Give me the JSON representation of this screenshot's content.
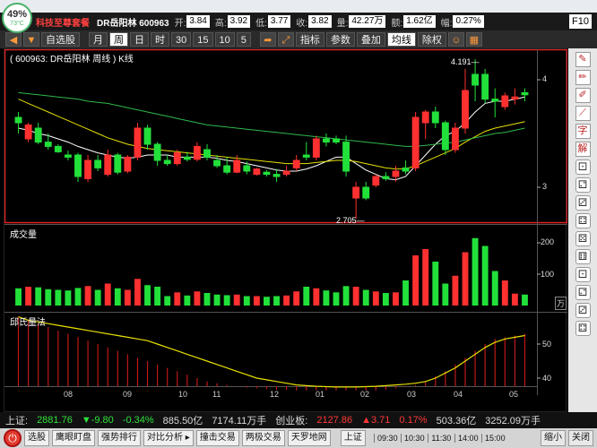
{
  "system": {
    "cpu_percent": "49%",
    "temperature": "73°C"
  },
  "header": {
    "brand": "科技至尊套餐",
    "stock": "DR岳阳林  600963",
    "fields": [
      {
        "label": "开:",
        "value": "3.84"
      },
      {
        "label": "高:",
        "value": "3.92"
      },
      {
        "label": "低:",
        "value": "3.77"
      },
      {
        "label": "收:",
        "value": "3.82"
      },
      {
        "label": "量:",
        "value": "42.27万"
      },
      {
        "label": "额:",
        "value": "1.62亿"
      },
      {
        "label": "幅:",
        "value": "0.27%"
      }
    ],
    "f10": "F10"
  },
  "toolbar": {
    "nav_left": "◀",
    "nav_down": "▼",
    "self_select": "自选股",
    "periods": [
      "月",
      "周",
      "日",
      "时",
      "30",
      "15",
      "10",
      "5"
    ],
    "active_period": "周",
    "indicator": "指标",
    "params": "参数",
    "overlay": "叠加",
    "ma_line": "均线",
    "ex_right": "除权"
  },
  "chart": {
    "title": "( 600963: DR岳阳林 周线 ) K线",
    "volume_title": "成交量",
    "osc_title": "邱氏量法",
    "price_ticks": [
      "4",
      "3"
    ],
    "volume_ticks": [
      "200",
      "100"
    ],
    "volume_unit": "万",
    "osc_ticks": [
      "50",
      "40"
    ],
    "x_ticks": [
      "08",
      "09",
      "10",
      "11",
      "12",
      "01",
      "02",
      "03",
      "04",
      "05"
    ],
    "high_marker": "4.191",
    "low_marker": "2.705"
  },
  "sidetools_icons": [
    "pen-icon",
    "pencil-icon",
    "brush-icon",
    "slash-icon",
    "text-icon",
    "explain-icon",
    "dice-1-icon",
    "dice-2-icon",
    "dice-3-icon",
    "dice-4-icon",
    "dice-5-icon",
    "dice-6-icon",
    "dice-7-icon",
    "dice-8-icon",
    "dice-9-icon",
    "dice-10-icon"
  ],
  "sidetools_text": {
    "char": "字",
    "explain": "解"
  },
  "status": {
    "sh_label": "上证:",
    "sh_value": "2881.76",
    "sh_change": "▼-9.80",
    "sh_pct": "-0.34%",
    "sh_amount": "885.50亿",
    "sh_volume": "7174.11万手",
    "cy_label": "创业板:",
    "cy_value": "2127.86",
    "cy_change": "▲3.71",
    "cy_pct": "0.17%",
    "cy_amount": "503.36亿",
    "cy_volume": "3252.09万手"
  },
  "bottom": {
    "buttons": [
      "选股",
      "鹰眼盯盘",
      "强势排行",
      "对比分析 ▸",
      "撞击交易",
      "两极交易",
      "天罗地网"
    ],
    "index_button": "上证",
    "times": [
      "09:30",
      "10:30",
      "11:30",
      "14:00",
      "15:00"
    ],
    "shrink": "缩小",
    "close": "关闭"
  },
  "colors": {
    "up": "#ff3030",
    "down": "#22e03a",
    "ma_white": "#ffffff",
    "ma_yellow": "#e8e000",
    "ma_green": "#2fb84a",
    "frame": "#e02020"
  },
  "chart_data": {
    "type": "candlestick",
    "period": "weekly",
    "price_axis": {
      "visible_ticks": [
        3,
        4
      ],
      "range_approx": [
        2.65,
        4.35
      ]
    },
    "extremes": {
      "high": 4.191,
      "low": 2.705
    },
    "candles": [
      {
        "o": 3.65,
        "h": 3.7,
        "l": 3.5,
        "c": 3.6,
        "up": false
      },
      {
        "o": 3.45,
        "h": 3.6,
        "l": 3.42,
        "c": 3.58,
        "up": true
      },
      {
        "o": 3.55,
        "h": 3.6,
        "l": 3.4,
        "c": 3.42,
        "up": false
      },
      {
        "o": 3.42,
        "h": 3.5,
        "l": 3.35,
        "c": 3.38,
        "up": false
      },
      {
        "o": 3.38,
        "h": 3.4,
        "l": 3.32,
        "c": 3.33,
        "up": false
      },
      {
        "o": 3.28,
        "h": 3.34,
        "l": 3.25,
        "c": 3.3,
        "up": false
      },
      {
        "o": 3.3,
        "h": 3.32,
        "l": 3.05,
        "c": 3.1,
        "up": false
      },
      {
        "o": 3.08,
        "h": 3.3,
        "l": 3.05,
        "c": 3.25,
        "up": true
      },
      {
        "o": 3.25,
        "h": 3.3,
        "l": 3.15,
        "c": 3.18,
        "up": false
      },
      {
        "o": 3.12,
        "h": 3.35,
        "l": 3.1,
        "c": 3.3,
        "up": true
      },
      {
        "o": 3.3,
        "h": 3.32,
        "l": 3.12,
        "c": 3.14,
        "up": false
      },
      {
        "o": 3.15,
        "h": 3.3,
        "l": 3.13,
        "c": 3.28,
        "up": true
      },
      {
        "o": 3.28,
        "h": 3.6,
        "l": 3.25,
        "c": 3.55,
        "up": true
      },
      {
        "o": 3.55,
        "h": 3.58,
        "l": 3.35,
        "c": 3.4,
        "up": false
      },
      {
        "o": 3.4,
        "h": 3.42,
        "l": 3.2,
        "c": 3.25,
        "up": false
      },
      {
        "o": 3.25,
        "h": 3.3,
        "l": 3.2,
        "c": 3.22,
        "up": false
      },
      {
        "o": 3.22,
        "h": 3.35,
        "l": 3.2,
        "c": 3.32,
        "up": true
      },
      {
        "o": 3.28,
        "h": 3.33,
        "l": 3.24,
        "c": 3.26,
        "up": false
      },
      {
        "o": 3.26,
        "h": 3.42,
        "l": 3.24,
        "c": 3.38,
        "up": true
      },
      {
        "o": 3.35,
        "h": 3.4,
        "l": 3.25,
        "c": 3.28,
        "up": false
      },
      {
        "o": 3.25,
        "h": 3.3,
        "l": 3.18,
        "c": 3.2,
        "up": false
      },
      {
        "o": 3.2,
        "h": 3.28,
        "l": 3.12,
        "c": 3.14,
        "up": false
      },
      {
        "o": 3.14,
        "h": 3.3,
        "l": 3.13,
        "c": 3.25,
        "up": true
      },
      {
        "o": 3.2,
        "h": 3.24,
        "l": 3.12,
        "c": 3.15,
        "up": false
      },
      {
        "o": 3.12,
        "h": 3.18,
        "l": 3.11,
        "c": 3.17,
        "up": true
      },
      {
        "o": 3.12,
        "h": 3.16,
        "l": 3.1,
        "c": 3.14,
        "up": false
      },
      {
        "o": 3.1,
        "h": 3.17,
        "l": 3.05,
        "c": 3.12,
        "up": false
      },
      {
        "o": 3.12,
        "h": 3.2,
        "l": 3.1,
        "c": 3.15,
        "up": true
      },
      {
        "o": 3.18,
        "h": 3.3,
        "l": 3.15,
        "c": 3.25,
        "up": true
      },
      {
        "o": 3.3,
        "h": 3.42,
        "l": 3.25,
        "c": 3.28,
        "up": false
      },
      {
        "o": 3.28,
        "h": 3.48,
        "l": 3.25,
        "c": 3.45,
        "up": true
      },
      {
        "o": 3.45,
        "h": 3.5,
        "l": 3.38,
        "c": 3.42,
        "up": false
      },
      {
        "o": 3.45,
        "h": 3.48,
        "l": 3.4,
        "c": 3.42,
        "up": false
      },
      {
        "o": 3.42,
        "h": 3.48,
        "l": 3.1,
        "c": 3.15,
        "up": false
      },
      {
        "o": 3.0,
        "h": 3.05,
        "l": 2.705,
        "c": 2.9,
        "up": true
      },
      {
        "o": 2.9,
        "h": 3.05,
        "l": 2.88,
        "c": 3.0,
        "up": false
      },
      {
        "o": 3.02,
        "h": 3.12,
        "l": 3.0,
        "c": 3.1,
        "up": true
      },
      {
        "o": 3.1,
        "h": 3.14,
        "l": 3.06,
        "c": 3.08,
        "up": false
      },
      {
        "o": 3.1,
        "h": 3.2,
        "l": 3.05,
        "c": 3.15,
        "up": true
      },
      {
        "o": 3.15,
        "h": 3.25,
        "l": 3.12,
        "c": 3.18,
        "up": false
      },
      {
        "o": 3.18,
        "h": 3.7,
        "l": 3.15,
        "c": 3.65,
        "up": true
      },
      {
        "o": 3.6,
        "h": 3.72,
        "l": 3.45,
        "c": 3.7,
        "up": true
      },
      {
        "o": 3.7,
        "h": 3.75,
        "l": 3.55,
        "c": 3.6,
        "up": false
      },
      {
        "o": 3.6,
        "h": 3.62,
        "l": 3.3,
        "c": 3.35,
        "up": false
      },
      {
        "o": 3.35,
        "h": 3.6,
        "l": 3.32,
        "c": 3.55,
        "up": true
      },
      {
        "o": 3.55,
        "h": 4.1,
        "l": 3.5,
        "c": 3.9,
        "up": true
      },
      {
        "o": 3.95,
        "h": 4.191,
        "l": 3.8,
        "c": 4.05,
        "up": false
      },
      {
        "o": 4.05,
        "h": 4.1,
        "l": 3.78,
        "c": 3.82,
        "up": false
      },
      {
        "o": 3.82,
        "h": 3.92,
        "l": 3.65,
        "c": 3.8,
        "up": false
      },
      {
        "o": 3.75,
        "h": 3.88,
        "l": 3.72,
        "c": 3.85,
        "up": true
      },
      {
        "o": 3.82,
        "h": 3.92,
        "l": 3.77,
        "c": 3.84,
        "up": true
      },
      {
        "o": 3.88,
        "h": 3.92,
        "l": 3.8,
        "c": 3.86,
        "up": false
      }
    ],
    "ma_white": [
      3.55,
      3.53,
      3.5,
      3.48,
      3.45,
      3.42,
      3.38,
      3.35,
      3.32,
      3.3,
      3.28,
      3.27,
      3.28,
      3.3,
      3.3,
      3.3,
      3.28,
      3.28,
      3.28,
      3.28,
      3.27,
      3.25,
      3.24,
      3.22,
      3.2,
      3.18,
      3.16,
      3.15,
      3.15,
      3.17,
      3.2,
      3.24,
      3.28,
      3.28,
      3.22,
      3.16,
      3.12,
      3.08,
      3.07,
      3.1,
      3.2,
      3.3,
      3.4,
      3.48,
      3.52,
      3.6,
      3.7,
      3.78,
      3.8,
      3.8,
      3.82,
      3.84
    ],
    "ma_yellow": [
      3.82,
      3.78,
      3.74,
      3.7,
      3.66,
      3.62,
      3.58,
      3.54,
      3.5,
      3.46,
      3.43,
      3.4,
      3.38,
      3.36,
      3.35,
      3.34,
      3.33,
      3.32,
      3.31,
      3.3,
      3.29,
      3.28,
      3.27,
      3.26,
      3.25,
      3.24,
      3.23,
      3.22,
      3.22,
      3.22,
      3.23,
      3.24,
      3.25,
      3.25,
      3.24,
      3.22,
      3.2,
      3.18,
      3.17,
      3.17,
      3.2,
      3.24,
      3.28,
      3.32,
      3.36,
      3.42,
      3.47,
      3.52,
      3.55,
      3.57,
      3.59,
      3.61
    ],
    "ma_green": [
      3.88,
      3.87,
      3.86,
      3.85,
      3.84,
      3.83,
      3.82,
      3.8,
      3.79,
      3.78,
      3.76,
      3.74,
      3.72,
      3.7,
      3.68,
      3.66,
      3.64,
      3.62,
      3.6,
      3.58,
      3.57,
      3.56,
      3.55,
      3.54,
      3.53,
      3.52,
      3.51,
      3.5,
      3.49,
      3.48,
      3.47,
      3.46,
      3.45,
      3.44,
      3.43,
      3.42,
      3.41,
      3.4,
      3.39,
      3.38,
      3.38,
      3.39,
      3.4,
      3.41,
      3.42,
      3.44,
      3.46,
      3.48,
      3.5,
      3.51,
      3.53,
      3.55
    ],
    "volume": [
      {
        "v": 55,
        "up": false
      },
      {
        "v": 60,
        "up": true
      },
      {
        "v": 58,
        "up": false
      },
      {
        "v": 52,
        "up": false
      },
      {
        "v": 50,
        "up": false
      },
      {
        "v": 48,
        "up": false
      },
      {
        "v": 56,
        "up": false
      },
      {
        "v": 62,
        "up": true
      },
      {
        "v": 50,
        "up": false
      },
      {
        "v": 70,
        "up": true
      },
      {
        "v": 55,
        "up": false
      },
      {
        "v": 50,
        "up": true
      },
      {
        "v": 85,
        "up": true
      },
      {
        "v": 65,
        "up": false
      },
      {
        "v": 60,
        "up": false
      },
      {
        "v": 30,
        "up": false
      },
      {
        "v": 42,
        "up": true
      },
      {
        "v": 32,
        "up": false
      },
      {
        "v": 45,
        "up": true
      },
      {
        "v": 40,
        "up": false
      },
      {
        "v": 35,
        "up": false
      },
      {
        "v": 33,
        "up": false
      },
      {
        "v": 35,
        "up": true
      },
      {
        "v": 30,
        "up": false
      },
      {
        "v": 30,
        "up": true
      },
      {
        "v": 28,
        "up": false
      },
      {
        "v": 30,
        "up": false
      },
      {
        "v": 32,
        "up": true
      },
      {
        "v": 45,
        "up": true
      },
      {
        "v": 60,
        "up": false
      },
      {
        "v": 55,
        "up": true
      },
      {
        "v": 48,
        "up": false
      },
      {
        "v": 42,
        "up": false
      },
      {
        "v": 62,
        "up": false
      },
      {
        "v": 60,
        "up": true
      },
      {
        "v": 50,
        "up": false
      },
      {
        "v": 45,
        "up": true
      },
      {
        "v": 40,
        "up": false
      },
      {
        "v": 42,
        "up": true
      },
      {
        "v": 80,
        "up": false
      },
      {
        "v": 160,
        "up": true
      },
      {
        "v": 180,
        "up": true
      },
      {
        "v": 140,
        "up": false
      },
      {
        "v": 70,
        "up": false
      },
      {
        "v": 95,
        "up": true
      },
      {
        "v": 170,
        "up": true
      },
      {
        "v": 215,
        "up": false
      },
      {
        "v": 190,
        "up": false
      },
      {
        "v": 110,
        "up": false
      },
      {
        "v": 80,
        "up": true
      },
      {
        "v": 38,
        "up": true
      },
      {
        "v": 35,
        "up": false
      }
    ],
    "osc_line": [
      58,
      57,
      56.5,
      56,
      55.5,
      55,
      54.5,
      54,
      53.5,
      53,
      52.5,
      52,
      51.5,
      51,
      50,
      49,
      48,
      47,
      46,
      45,
      44,
      43,
      42,
      41,
      40,
      39.5,
      39,
      38.5,
      38,
      37.8,
      37.6,
      37.5,
      37.4,
      37.4,
      37.4,
      37.5,
      37.6,
      37.8,
      38,
      38.2,
      38.5,
      39,
      40,
      41.5,
      43,
      45,
      47,
      49,
      50.5,
      51.5,
      52,
      52.5
    ],
    "osc_bars": [
      58,
      57,
      56,
      55,
      54,
      53,
      52,
      51,
      50,
      49,
      48,
      47,
      46,
      45,
      44,
      43,
      42,
      41,
      40,
      39,
      38.5,
      38,
      37.5,
      37.2,
      37,
      36.8,
      36.6,
      36.5,
      36.4,
      36.4,
      36.4,
      36.4,
      36.4,
      36.4,
      36.4,
      36.4,
      36.4,
      36.6,
      37,
      37.5,
      38,
      39,
      40.5,
      42,
      44,
      46,
      48,
      50,
      51.5,
      52,
      52.5,
      53
    ]
  }
}
